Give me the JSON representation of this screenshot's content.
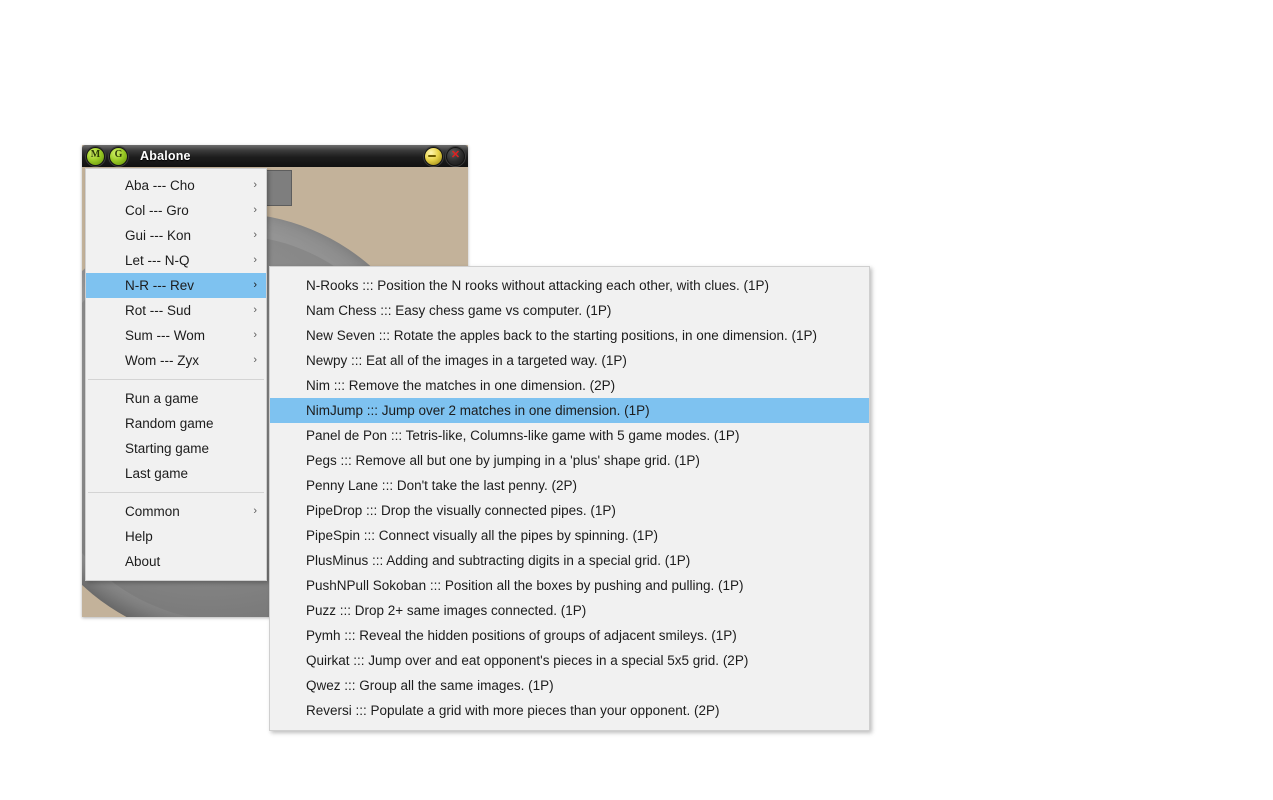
{
  "window": {
    "title": "Abalone",
    "badges": [
      "M",
      "G"
    ],
    "minimize_label": "–",
    "close_label": "✕",
    "toolbar_button_count": 5
  },
  "colors": {
    "highlight": "#7ec2f0",
    "menu_bg": "#f1f1f1",
    "board_felt": "#c3b29a",
    "marble_red": "#ec1c1c",
    "titlebar": "#1d1d1d"
  },
  "main_menu": {
    "groups": [
      {
        "items": [
          {
            "label": "Aba --- Cho",
            "submenu": true,
            "selected": false
          },
          {
            "label": "Col --- Gro",
            "submenu": true,
            "selected": false
          },
          {
            "label": "Gui --- Kon",
            "submenu": true,
            "selected": false
          },
          {
            "label": "Let --- N-Q",
            "submenu": true,
            "selected": false
          },
          {
            "label": "N-R --- Rev",
            "submenu": true,
            "selected": true
          },
          {
            "label": "Rot --- Sud",
            "submenu": true,
            "selected": false
          },
          {
            "label": "Sum --- Wom",
            "submenu": true,
            "selected": false
          },
          {
            "label": "Wom --- Zyx",
            "submenu": true,
            "selected": false
          }
        ]
      },
      {
        "items": [
          {
            "label": "Run a game",
            "submenu": false,
            "selected": false
          },
          {
            "label": "Random game",
            "submenu": false,
            "selected": false
          },
          {
            "label": "Starting game",
            "submenu": false,
            "selected": false
          },
          {
            "label": "Last game",
            "submenu": false,
            "selected": false
          }
        ]
      },
      {
        "items": [
          {
            "label": "Common",
            "submenu": true,
            "selected": false
          },
          {
            "label": "Help",
            "submenu": false,
            "selected": false
          },
          {
            "label": "About",
            "submenu": false,
            "selected": false
          }
        ]
      }
    ],
    "chevron": "›"
  },
  "sub_menu": {
    "items": [
      {
        "label": "N-Rooks ::: Position the N rooks without attacking each other, with clues. (1P)",
        "selected": false
      },
      {
        "label": "Nam Chess ::: Easy chess game vs computer. (1P)",
        "selected": false
      },
      {
        "label": "New Seven ::: Rotate the apples back to the starting positions, in one dimension. (1P)",
        "selected": false
      },
      {
        "label": "Newpy ::: Eat all of the images in a targeted way. (1P)",
        "selected": false
      },
      {
        "label": "Nim ::: Remove the matches in one dimension. (2P)",
        "selected": false
      },
      {
        "label": "NimJump ::: Jump over 2 matches in one dimension. (1P)",
        "selected": true
      },
      {
        "label": "Panel de Pon ::: Tetris-like, Columns-like game with 5 game modes. (1P)",
        "selected": false
      },
      {
        "label": "Pegs ::: Remove all but one by jumping in a 'plus' shape grid. (1P)",
        "selected": false
      },
      {
        "label": "Penny Lane ::: Don't take the last penny. (2P)",
        "selected": false
      },
      {
        "label": "PipeDrop ::: Drop the visually connected pipes. (1P)",
        "selected": false
      },
      {
        "label": "PipeSpin ::: Connect visually all the pipes by spinning. (1P)",
        "selected": false
      },
      {
        "label": "PlusMinus ::: Adding and subtracting digits in a special grid. (1P)",
        "selected": false
      },
      {
        "label": "PushNPull Sokoban ::: Position all the boxes by pushing and pulling. (1P)",
        "selected": false
      },
      {
        "label": "Puzz ::: Drop 2+ same images connected. (1P)",
        "selected": false
      },
      {
        "label": "Pymh ::: Reveal the hidden positions of groups of adjacent smileys. (1P)",
        "selected": false
      },
      {
        "label": "Quirkat ::: Jump over and eat opponent's pieces in a special 5x5 grid. (2P)",
        "selected": false
      },
      {
        "label": "Qwez ::: Group all the same images. (1P)",
        "selected": false
      },
      {
        "label": "Reversi ::: Populate a grid with more pieces than your opponent. (2P)",
        "selected": false
      }
    ]
  }
}
